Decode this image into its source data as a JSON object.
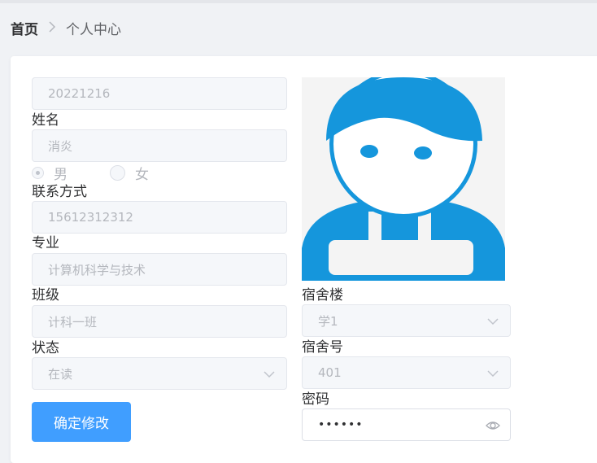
{
  "breadcrumb": {
    "home": "首页",
    "separator": ">",
    "current": "个人中心"
  },
  "form": {
    "student_id": "20221216",
    "name_label": "姓名",
    "name_value": "消炎",
    "gender_options": [
      "男",
      "女"
    ],
    "gender_selected": "男",
    "contact_label": "联系方式",
    "contact_value": "15612312312",
    "major_label": "专业",
    "major_value": "计算机科学与技术",
    "class_label": "班级",
    "class_value": "计科一班",
    "status_label": "状态",
    "status_value": "在读",
    "dorm_building_label": "宿舍楼",
    "dorm_building_value": "学1",
    "dorm_room_label": "宿舍号",
    "dorm_room_value": "401",
    "password_label": "密码",
    "password_masked": "••••••",
    "submit_label": "确定修改"
  },
  "icons": {
    "breadcrumb_separator": "chevron-right-icon",
    "select_arrow": "chevron-down-icon",
    "password_toggle": "eye-icon",
    "avatar": "avatar-image"
  },
  "colors": {
    "primary": "#409eff",
    "avatar_blue": "#1596dc",
    "disabled_bg": "#f5f7fa"
  }
}
